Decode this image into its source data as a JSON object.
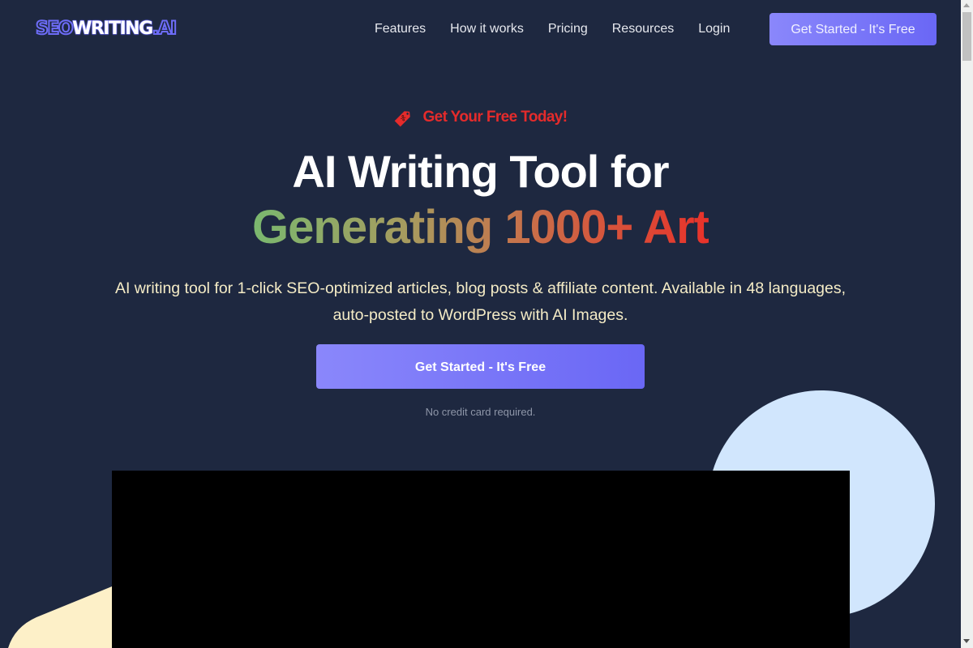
{
  "logo": {
    "part1": "SEO",
    "part2": "WRITING",
    "part3": ".AI"
  },
  "nav": {
    "links": [
      {
        "label": "Features"
      },
      {
        "label": "How it works"
      },
      {
        "label": "Pricing"
      },
      {
        "label": "Resources"
      },
      {
        "label": "Login"
      }
    ],
    "cta_label": "Get Started - It's Free"
  },
  "hero": {
    "badge_icon": "price-tag-icon",
    "badge_text": "Get Your Free Today!",
    "title_line1": "AI Writing Tool for",
    "title_line2": "Generating 1000+ Art",
    "subtitle": "AI writing tool for 1-click SEO-optimized articles, blog posts & affiliate content. Available in 48 languages, auto-posted to WordPress with AI Images.",
    "cta_label": "Get Started - It's Free",
    "note": "No credit card required."
  },
  "colors": {
    "background": "#1e2840",
    "accent": "#6d6cf7",
    "badge_red": "#e52b2b",
    "subtitle": "#f5ecc6",
    "circle": "#d1e6fd",
    "wedge": "#fdf0c8"
  }
}
